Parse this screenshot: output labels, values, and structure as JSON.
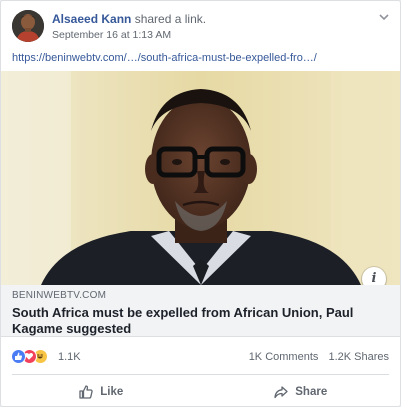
{
  "post": {
    "author": "Alsaeed Kann",
    "action": "shared a link.",
    "timestamp": "September 16 at 1:13 AM",
    "link_url": "https://beninwebtv.com/…/south-africa-must-be-expelled-fro…/"
  },
  "card": {
    "domain": "BENINWEBTV.COM",
    "headline": "South Africa must be expelled from African Union, Paul Kagame suggested",
    "info_glyph": "i"
  },
  "stats": {
    "reactions": [
      "like",
      "love",
      "haha"
    ],
    "reaction_count": "1.1K",
    "comments": "1K Comments",
    "shares": "1.2K Shares"
  },
  "actions": {
    "like_label": "Like",
    "share_label": "Share"
  },
  "colors": {
    "link": "#365899",
    "caption_bg": "#f2f3f5",
    "meta": "#606770"
  }
}
